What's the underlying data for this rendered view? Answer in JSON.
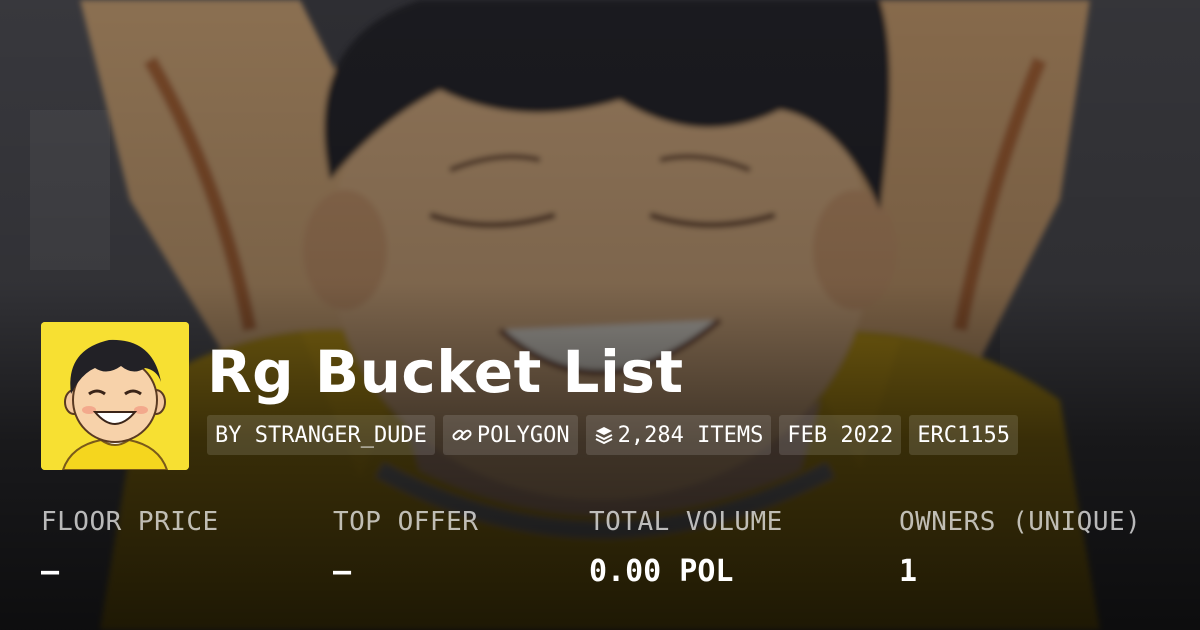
{
  "collection": {
    "name": "Rg Bucket List",
    "tags": {
      "creator": "BY STRANGER_DUDE",
      "chain": "POLYGON",
      "items": "2,284 ITEMS",
      "date": "FEB 2022",
      "standard": "ERC1155"
    }
  },
  "stats": {
    "floor_price": {
      "label": "FLOOR PRICE",
      "value": "—"
    },
    "top_offer": {
      "label": "TOP OFFER",
      "value": "—"
    },
    "total_volume": {
      "label": "TOTAL VOLUME",
      "value": "0.00 POL"
    },
    "owners": {
      "label": "OWNERS (UNIQUE)",
      "value": "1"
    }
  },
  "icons": {
    "chain": "link-icon",
    "items": "layers-icon"
  },
  "colors": {
    "avatar_bg": "#f7e032",
    "shirt": "#f2c21b",
    "skin": "#f0c79a",
    "hair": "#1f1e22"
  }
}
